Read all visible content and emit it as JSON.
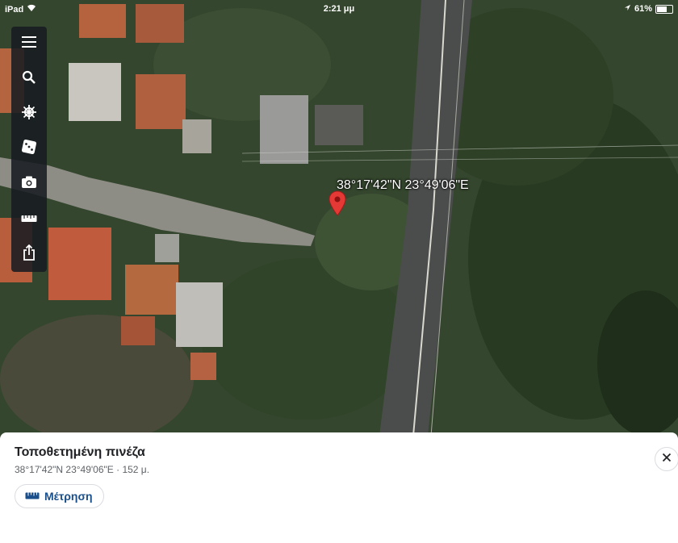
{
  "status_bar": {
    "device": "iPad",
    "time": "2:21 μμ",
    "battery": "61%",
    "battery_level": 0.61
  },
  "toolbar": {
    "items": [
      {
        "icon": "menu-icon"
      },
      {
        "icon": "search-icon"
      },
      {
        "icon": "voyager-icon"
      },
      {
        "icon": "dice-icon"
      },
      {
        "icon": "camera-icon"
      },
      {
        "icon": "ruler-icon"
      },
      {
        "icon": "share-icon"
      }
    ]
  },
  "map": {
    "pin_label": "38°17'42\"N 23°49'06\"E",
    "pin_color": "#e53935"
  },
  "panel": {
    "title": "Τοποθετημένη πινέζα",
    "subtitle": "38°17'42\"N 23°49'06\"E · 152 μ.",
    "measure_label": "Μέτρηση",
    "accent_color": "#1a4f8b"
  }
}
